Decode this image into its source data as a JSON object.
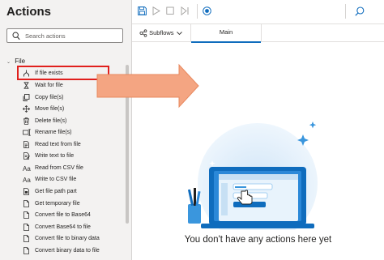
{
  "actions_panel": {
    "title": "Actions",
    "search_placeholder": "Search actions",
    "group_label": "File",
    "items": [
      {
        "label": "If file exists",
        "icon": "branch-icon"
      },
      {
        "label": "Wait for file",
        "icon": "hourglass-icon"
      },
      {
        "label": "Copy file(s)",
        "icon": "copy-icon"
      },
      {
        "label": "Move file(s)",
        "icon": "move-icon"
      },
      {
        "label": "Delete file(s)",
        "icon": "trash-icon"
      },
      {
        "label": "Rename file(s)",
        "icon": "rename-icon"
      },
      {
        "label": "Read text from file",
        "icon": "file-text-icon"
      },
      {
        "label": "Write text to file",
        "icon": "file-write-icon"
      },
      {
        "label": "Read from CSV file",
        "icon": "text-aa-icon"
      },
      {
        "label": "Write to CSV file",
        "icon": "text-aa-icon"
      },
      {
        "label": "Get file path part",
        "icon": "file-path-icon"
      },
      {
        "label": "Get temporary file",
        "icon": "file-icon"
      },
      {
        "label": "Convert file to Base64",
        "icon": "file-icon"
      },
      {
        "label": "Convert Base64 to file",
        "icon": "file-icon"
      },
      {
        "label": "Convert file to binary data",
        "icon": "file-icon"
      },
      {
        "label": "Convert binary data to file",
        "icon": "file-icon"
      }
    ]
  },
  "tabs": {
    "subflows_label": "Subflows",
    "main_label": "Main"
  },
  "canvas": {
    "empty_message": "You don't have any actions here yet"
  },
  "colors": {
    "highlight": "#e0201d",
    "arrow": "#f4a582",
    "accent": "#0f6cbd"
  }
}
